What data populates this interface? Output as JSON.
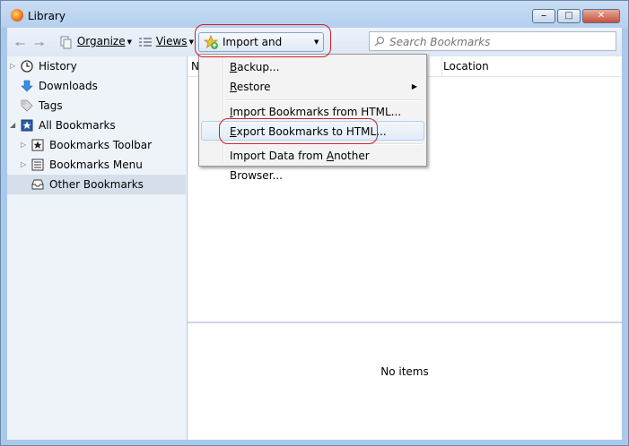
{
  "window": {
    "title": "Library",
    "icon": "firefox-icon",
    "controls": [
      "minimize",
      "maximize",
      "close"
    ]
  },
  "toolbar": {
    "back_icon": "back-arrow-icon",
    "forward_icon": "forward-arrow-icon",
    "organize_label": "Organize",
    "views_label": "Views",
    "import_backup_label": "Import and Backup",
    "search_placeholder": "Search Bookmarks"
  },
  "sidebar": {
    "items": [
      {
        "label": "History",
        "icon": "clock-icon"
      },
      {
        "label": "Downloads",
        "icon": "download-arrow-icon"
      },
      {
        "label": "Tags",
        "icon": "tag-icon"
      },
      {
        "label": "All Bookmarks",
        "icon": "bookmarks-star-icon"
      },
      {
        "label": "Bookmarks Toolbar",
        "icon": "star-toolbar-icon"
      },
      {
        "label": "Bookmarks Menu",
        "icon": "menu-list-icon"
      },
      {
        "label": "Other Bookmarks",
        "icon": "folder-tray-icon",
        "selected": true
      }
    ]
  },
  "content": {
    "columns": [
      "N",
      "Location"
    ],
    "empty_message": "No items"
  },
  "menu": {
    "items": [
      {
        "pre": "",
        "key": "B",
        "post": "ackup..."
      },
      {
        "pre": "",
        "key": "R",
        "post": "estore"
      },
      {
        "pre": "",
        "key": "I",
        "post": "mport Bookmarks from HTML..."
      },
      {
        "pre": "",
        "key": "E",
        "post": "xport Bookmarks to HTML..."
      },
      {
        "pre": "Import Data from ",
        "key": "A",
        "post": "nother Browser..."
      }
    ]
  },
  "colors": {
    "highlight_ring": "#d21e2b",
    "window_frame": "#a9c8ea"
  }
}
